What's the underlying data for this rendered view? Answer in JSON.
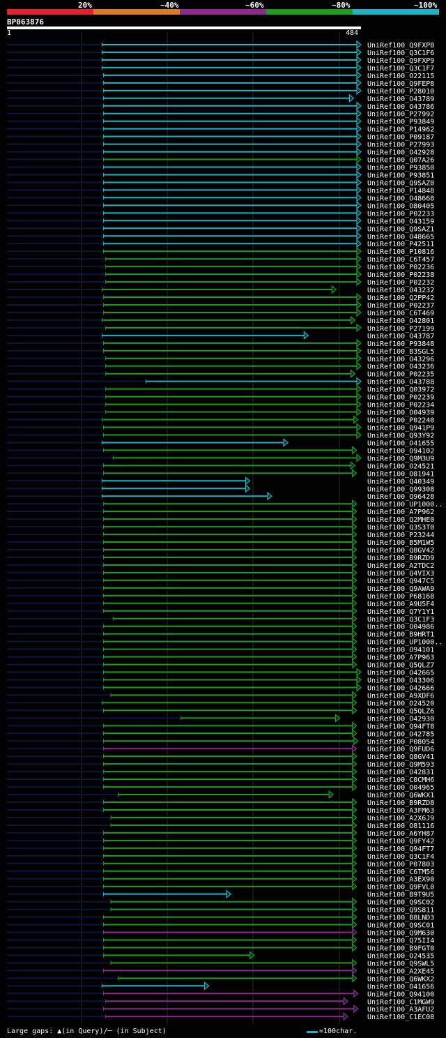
{
  "legend": {
    "labels": [
      "20%",
      "~40%",
      "~60%",
      "~80%",
      "~100%"
    ],
    "colors": [
      "#e8202a",
      "#e07a1e",
      "#8e2a8e",
      "#18a018",
      "#18b6c8"
    ]
  },
  "query": {
    "name": "BP063876",
    "start": "1",
    "end": "484"
  },
  "footer": {
    "gaps_text": "Large gaps: ▲(in Query)/─ (in Subject)",
    "scale_text": "=100char."
  },
  "chart_data": {
    "type": "alignment",
    "query_length": 484,
    "colors": {
      "red": "#e8202a",
      "orange": "#e07a1e",
      "purple": "#8e2a8e",
      "green": "#18a018",
      "cyan": "#18b6c8",
      "navy": "#0c1444"
    },
    "hits": [
      {
        "name": "UniRef100_Q9FXP8",
        "start": 130,
        "end": 484,
        "color": "cyan"
      },
      {
        "name": "UniRef100_Q3C1F6",
        "start": 130,
        "end": 484,
        "color": "cyan"
      },
      {
        "name": "UniRef100_Q9FXP9",
        "start": 130,
        "end": 484,
        "color": "cyan"
      },
      {
        "name": "UniRef100_Q3C1F7",
        "start": 130,
        "end": 484,
        "color": "cyan"
      },
      {
        "name": "UniRef100_O22115",
        "start": 132,
        "end": 484,
        "color": "cyan"
      },
      {
        "name": "UniRef100_Q9FEP8",
        "start": 132,
        "end": 484,
        "color": "cyan"
      },
      {
        "name": "UniRef100_P28010",
        "start": 132,
        "end": 484,
        "color": "cyan"
      },
      {
        "name": "UniRef100_O43789",
        "start": 132,
        "end": 474,
        "color": "cyan"
      },
      {
        "name": "UniRef100_O43786",
        "start": 132,
        "end": 484,
        "color": "cyan"
      },
      {
        "name": "UniRef100_P27992",
        "start": 132,
        "end": 484,
        "color": "cyan"
      },
      {
        "name": "UniRef100_P93849",
        "start": 132,
        "end": 484,
        "color": "cyan"
      },
      {
        "name": "UniRef100_P14962",
        "start": 132,
        "end": 484,
        "color": "cyan"
      },
      {
        "name": "UniRef100_P09187",
        "start": 132,
        "end": 484,
        "color": "cyan"
      },
      {
        "name": "UniRef100_P27993",
        "start": 132,
        "end": 484,
        "color": "cyan"
      },
      {
        "name": "UniRef100_O42928",
        "start": 132,
        "end": 484,
        "color": "cyan"
      },
      {
        "name": "UniRef100_Q07A26",
        "start": 132,
        "end": 484,
        "color": "green"
      },
      {
        "name": "UniRef100_P93850",
        "start": 132,
        "end": 484,
        "color": "cyan"
      },
      {
        "name": "UniRef100_P93851",
        "start": 132,
        "end": 484,
        "color": "cyan"
      },
      {
        "name": "UniRef100_Q9SAZ0",
        "start": 132,
        "end": 484,
        "color": "cyan"
      },
      {
        "name": "UniRef100_P14848",
        "start": 132,
        "end": 484,
        "color": "cyan"
      },
      {
        "name": "UniRef100_O48668",
        "start": 132,
        "end": 484,
        "color": "cyan"
      },
      {
        "name": "UniRef100_O80405",
        "start": 132,
        "end": 484,
        "color": "cyan"
      },
      {
        "name": "UniRef100_P02233",
        "start": 132,
        "end": 484,
        "color": "cyan"
      },
      {
        "name": "UniRef100_O43159",
        "start": 132,
        "end": 484,
        "color": "cyan"
      },
      {
        "name": "UniRef100_Q9SAZ1",
        "start": 132,
        "end": 484,
        "color": "cyan"
      },
      {
        "name": "UniRef100_O48665",
        "start": 132,
        "end": 484,
        "color": "cyan"
      },
      {
        "name": "UniRef100_P42511",
        "start": 132,
        "end": 484,
        "color": "cyan"
      },
      {
        "name": "UniRef100_P10816",
        "start": 132,
        "end": 484,
        "color": "green"
      },
      {
        "name": "UniRef100_C6T457",
        "start": 135,
        "end": 484,
        "color": "green"
      },
      {
        "name": "UniRef100_P02236",
        "start": 135,
        "end": 484,
        "color": "green"
      },
      {
        "name": "UniRef100_P02238",
        "start": 135,
        "end": 484,
        "color": "green"
      },
      {
        "name": "UniRef100_P02232",
        "start": 135,
        "end": 484,
        "color": "green"
      },
      {
        "name": "UniRef100_O43232",
        "start": 130,
        "end": 450,
        "color": "green"
      },
      {
        "name": "UniRef100_Q2PP42",
        "start": 132,
        "end": 484,
        "color": "green"
      },
      {
        "name": "UniRef100_P02237",
        "start": 132,
        "end": 484,
        "color": "green"
      },
      {
        "name": "UniRef100_C6T469",
        "start": 132,
        "end": 484,
        "color": "green"
      },
      {
        "name": "UniRef100_O42801",
        "start": 130,
        "end": 476,
        "color": "green"
      },
      {
        "name": "UniRef100_P27199",
        "start": 135,
        "end": 484,
        "color": "green"
      },
      {
        "name": "UniRef100_O43787",
        "start": 130,
        "end": 412,
        "color": "cyan"
      },
      {
        "name": "UniRef100_P93848",
        "start": 132,
        "end": 484,
        "color": "green"
      },
      {
        "name": "UniRef100_B3SGL5",
        "start": 132,
        "end": 484,
        "color": "green"
      },
      {
        "name": "UniRef100_O43296",
        "start": 135,
        "end": 484,
        "color": "green"
      },
      {
        "name": "UniRef100_O43236",
        "start": 135,
        "end": 484,
        "color": "green"
      },
      {
        "name": "UniRef100_P02235",
        "start": 135,
        "end": 476,
        "color": "green"
      },
      {
        "name": "UniRef100_O43788",
        "start": 190,
        "end": 484,
        "color": "cyan"
      },
      {
        "name": "UniRef100_Q03972",
        "start": 135,
        "end": 484,
        "color": "green"
      },
      {
        "name": "UniRef100_P02239",
        "start": 135,
        "end": 484,
        "color": "green"
      },
      {
        "name": "UniRef100_P02234",
        "start": 135,
        "end": 484,
        "color": "green"
      },
      {
        "name": "UniRef100_O04939",
        "start": 135,
        "end": 484,
        "color": "green"
      },
      {
        "name": "UniRef100_P02240",
        "start": 130,
        "end": 480,
        "color": "green"
      },
      {
        "name": "UniRef100_Q941P9",
        "start": 132,
        "end": 484,
        "color": "green"
      },
      {
        "name": "UniRef100_Q93Y92",
        "start": 132,
        "end": 484,
        "color": "green"
      },
      {
        "name": "UniRef100_O41655",
        "start": 130,
        "end": 384,
        "color": "cyan"
      },
      {
        "name": "UniRef100_O94102",
        "start": 132,
        "end": 478,
        "color": "green"
      },
      {
        "name": "UniRef100_Q9M3U9",
        "start": 145,
        "end": 484,
        "color": "green"
      },
      {
        "name": "UniRef100_O24521",
        "start": 132,
        "end": 476,
        "color": "green"
      },
      {
        "name": "UniRef100_O81941",
        "start": 132,
        "end": 478,
        "color": "green"
      },
      {
        "name": "UniRef100_Q40349",
        "start": 130,
        "end": 332,
        "color": "cyan"
      },
      {
        "name": "UniRef100_Q99308",
        "start": 130,
        "end": 332,
        "color": "cyan"
      },
      {
        "name": "UniRef100_Q96428",
        "start": 130,
        "end": 362,
        "color": "cyan"
      },
      {
        "name": "UniRef100_UP1000..",
        "start": 132,
        "end": 478,
        "color": "green"
      },
      {
        "name": "UniRef100_A7P962",
        "start": 132,
        "end": 478,
        "color": "green"
      },
      {
        "name": "UniRef100_Q2MHE0",
        "start": 132,
        "end": 478,
        "color": "green"
      },
      {
        "name": "UniRef100_Q3S3T0",
        "start": 132,
        "end": 478,
        "color": "green"
      },
      {
        "name": "UniRef100_P23244",
        "start": 132,
        "end": 478,
        "color": "green"
      },
      {
        "name": "UniRef100_B5M1W5",
        "start": 132,
        "end": 478,
        "color": "green"
      },
      {
        "name": "UniRef100_Q8GV42",
        "start": 132,
        "end": 478,
        "color": "green"
      },
      {
        "name": "UniRef100_B9RZD9",
        "start": 132,
        "end": 478,
        "color": "green"
      },
      {
        "name": "UniRef100_A2TDC2",
        "start": 132,
        "end": 478,
        "color": "green"
      },
      {
        "name": "UniRef100_Q4VIX3",
        "start": 132,
        "end": 478,
        "color": "green"
      },
      {
        "name": "UniRef100_Q947C5",
        "start": 132,
        "end": 478,
        "color": "green"
      },
      {
        "name": "UniRef100_Q9AWA9",
        "start": 132,
        "end": 478,
        "color": "green"
      },
      {
        "name": "UniRef100_P68168",
        "start": 132,
        "end": 478,
        "color": "green"
      },
      {
        "name": "UniRef100_A9U5F4",
        "start": 132,
        "end": 478,
        "color": "green"
      },
      {
        "name": "UniRef100_Q7Y1Y1",
        "start": 132,
        "end": 478,
        "color": "green"
      },
      {
        "name": "UniRef100_Q3C1F3",
        "start": 145,
        "end": 478,
        "color": "green"
      },
      {
        "name": "UniRef100_O04986",
        "start": 132,
        "end": 478,
        "color": "green"
      },
      {
        "name": "UniRef100_B9HRT1",
        "start": 132,
        "end": 478,
        "color": "green"
      },
      {
        "name": "UniRef100_UP1000..",
        "start": 132,
        "end": 478,
        "color": "green"
      },
      {
        "name": "UniRef100_O94101",
        "start": 132,
        "end": 478,
        "color": "green"
      },
      {
        "name": "UniRef100_A7P963",
        "start": 132,
        "end": 478,
        "color": "green"
      },
      {
        "name": "UniRef100_Q5QLZ7",
        "start": 132,
        "end": 478,
        "color": "green"
      },
      {
        "name": "UniRef100_O42665",
        "start": 132,
        "end": 484,
        "color": "green"
      },
      {
        "name": "UniRef100_O43306",
        "start": 132,
        "end": 484,
        "color": "green"
      },
      {
        "name": "UniRef100_O42666",
        "start": 132,
        "end": 484,
        "color": "green"
      },
      {
        "name": "UniRef100_A9XDF6",
        "start": 142,
        "end": 478,
        "color": "green"
      },
      {
        "name": "UniRef100_O24520",
        "start": 130,
        "end": 478,
        "color": "green"
      },
      {
        "name": "UniRef100_Q5QLZ6",
        "start": 132,
        "end": 478,
        "color": "green"
      },
      {
        "name": "UniRef100_O42930",
        "start": 238,
        "end": 455,
        "color": "green"
      },
      {
        "name": "UniRef100_Q94FT8",
        "start": 132,
        "end": 478,
        "color": "green"
      },
      {
        "name": "UniRef100_O42785",
        "start": 132,
        "end": 478,
        "color": "green"
      },
      {
        "name": "UniRef100_P08054",
        "start": 132,
        "end": 480,
        "color": "green"
      },
      {
        "name": "UniRef100_Q9FUD6",
        "start": 132,
        "end": 478,
        "color": "purple"
      },
      {
        "name": "UniRef100_Q8GV41",
        "start": 132,
        "end": 478,
        "color": "green"
      },
      {
        "name": "UniRef100_Q9M593",
        "start": 132,
        "end": 478,
        "color": "green"
      },
      {
        "name": "UniRef100_O42831",
        "start": 132,
        "end": 478,
        "color": "green"
      },
      {
        "name": "UniRef100_C8CMH6",
        "start": 132,
        "end": 478,
        "color": "green"
      },
      {
        "name": "UniRef100_O04965",
        "start": 132,
        "end": 478,
        "color": "green"
      },
      {
        "name": "UniRef100_Q6WKX1",
        "start": 152,
        "end": 446,
        "color": "green"
      },
      {
        "name": "UniRef100_B9RZD8",
        "start": 132,
        "end": 478,
        "color": "green"
      },
      {
        "name": "UniRef100_A3FM63",
        "start": 132,
        "end": 478,
        "color": "green"
      },
      {
        "name": "UniRef100_A2X6J9",
        "start": 142,
        "end": 478,
        "color": "green"
      },
      {
        "name": "UniRef100_O81116",
        "start": 142,
        "end": 478,
        "color": "green"
      },
      {
        "name": "UniRef100_A6YH87",
        "start": 132,
        "end": 478,
        "color": "green"
      },
      {
        "name": "UniRef100_Q9FY42",
        "start": 132,
        "end": 478,
        "color": "green"
      },
      {
        "name": "UniRef100_Q94FT7",
        "start": 132,
        "end": 478,
        "color": "green"
      },
      {
        "name": "UniRef100_Q3C1F4",
        "start": 132,
        "end": 478,
        "color": "green"
      },
      {
        "name": "UniRef100_P07803",
        "start": 132,
        "end": 478,
        "color": "green"
      },
      {
        "name": "UniRef100_C6TM56",
        "start": 132,
        "end": 478,
        "color": "green"
      },
      {
        "name": "UniRef100_A3EX90",
        "start": 132,
        "end": 478,
        "color": "green"
      },
      {
        "name": "UniRef100_Q9FVL0",
        "start": 132,
        "end": 478,
        "color": "green"
      },
      {
        "name": "UniRef100_B9T9U5",
        "start": 132,
        "end": 306,
        "color": "cyan"
      },
      {
        "name": "UniRef100_Q9SC02",
        "start": 142,
        "end": 478,
        "color": "green"
      },
      {
        "name": "UniRef100_Q9S811",
        "start": 142,
        "end": 478,
        "color": "green"
      },
      {
        "name": "UniRef100_B8LND3",
        "start": 132,
        "end": 478,
        "color": "green"
      },
      {
        "name": "UniRef100_Q9SC01",
        "start": 132,
        "end": 478,
        "color": "green"
      },
      {
        "name": "UniRef100_Q9M630",
        "start": 132,
        "end": 478,
        "color": "purple"
      },
      {
        "name": "UniRef100_Q75II4",
        "start": 132,
        "end": 478,
        "color": "green"
      },
      {
        "name": "UniRef100_B9FGT0",
        "start": 132,
        "end": 478,
        "color": "green"
      },
      {
        "name": "UniRef100_O24535",
        "start": 132,
        "end": 338,
        "color": "green"
      },
      {
        "name": "UniRef100_Q9SWL5",
        "start": 142,
        "end": 478,
        "color": "green"
      },
      {
        "name": "UniRef100_A2XE45",
        "start": 132,
        "end": 478,
        "color": "purple"
      },
      {
        "name": "UniRef100_Q6WKX2",
        "start": 152,
        "end": 478,
        "color": "green"
      },
      {
        "name": "UniRef100_O41656",
        "start": 130,
        "end": 276,
        "color": "cyan"
      },
      {
        "name": "UniRef100_Q94100",
        "start": 132,
        "end": 480,
        "color": "purple"
      },
      {
        "name": "UniRef100_C1MGW9",
        "start": 135,
        "end": 466,
        "color": "purple"
      },
      {
        "name": "UniRef100_A3AFU2",
        "start": 132,
        "end": 480,
        "color": "purple"
      },
      {
        "name": "UniRef100_C1EC08",
        "start": 135,
        "end": 466,
        "color": "purple"
      }
    ]
  }
}
